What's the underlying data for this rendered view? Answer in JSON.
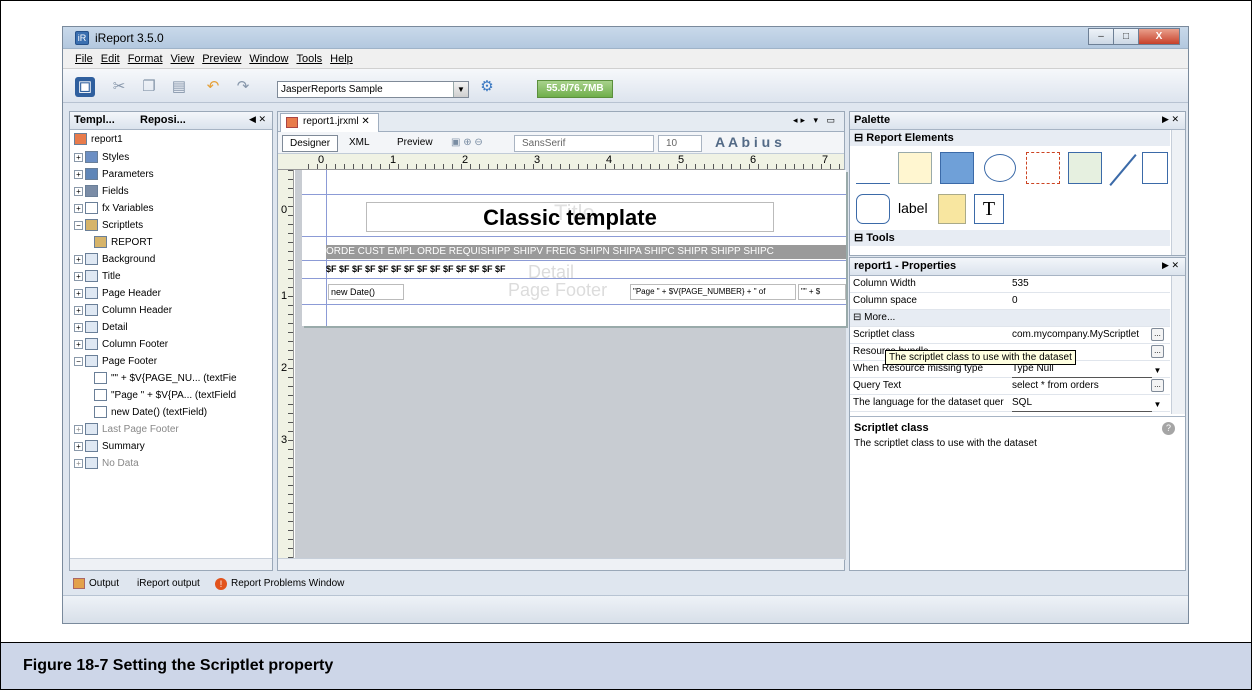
{
  "window": {
    "title": "iReport 3.5.0",
    "minimize": "–",
    "maximize": "□",
    "close": "X"
  },
  "menu": [
    "File",
    "Edit",
    "Format",
    "View",
    "Preview",
    "Window",
    "Tools",
    "Help"
  ],
  "toolbar": {
    "datasource": "JasperReports Sample",
    "memory": "55.8/76.7MB"
  },
  "left_panel": {
    "tabs": [
      "Templ...",
      "Reposi..."
    ],
    "root": "report1",
    "tree": [
      {
        "label": "Styles",
        "icon": "styles-icon"
      },
      {
        "label": "Parameters",
        "icon": "parameters-icon"
      },
      {
        "label": "Fields",
        "icon": "fields-icon"
      },
      {
        "label": "fx Variables",
        "icon": "variables-icon"
      },
      {
        "label": "Scriptlets",
        "icon": "scriptlets-icon",
        "expanded": true
      },
      {
        "label": "REPORT",
        "icon": "scriptlet-item-icon",
        "child": true
      },
      {
        "label": "Background",
        "icon": "band-icon"
      },
      {
        "label": "Title",
        "icon": "band-icon"
      },
      {
        "label": "Page Header",
        "icon": "band-icon"
      },
      {
        "label": "Column Header",
        "icon": "band-icon"
      },
      {
        "label": "Detail",
        "icon": "band-icon"
      },
      {
        "label": "Column Footer",
        "icon": "band-icon"
      },
      {
        "label": "Page Footer",
        "icon": "band-icon",
        "expanded": true
      },
      {
        "label": "\"\" + $V{PAGE_NU... (textFie",
        "icon": "textfield-icon",
        "child": true
      },
      {
        "label": "\"Page \" + $V{PA... (textField",
        "icon": "textfield-icon",
        "child": true
      },
      {
        "label": "new Date() (textField)",
        "icon": "textfield-icon",
        "child": true
      },
      {
        "label": "Last Page Footer",
        "icon": "band-icon",
        "dim": true
      },
      {
        "label": "Summary",
        "icon": "band-icon"
      },
      {
        "label": "No Data",
        "icon": "band-icon",
        "dim": true
      }
    ]
  },
  "editor": {
    "tab": "report1.jrxml",
    "modes": [
      "Designer",
      "XML",
      "Preview"
    ],
    "font": "SansSerif",
    "font_size": "10",
    "ruler_ticks": [
      "0",
      "1",
      "2",
      "3",
      "4",
      "5",
      "6",
      "7"
    ],
    "vruler_ticks": [
      "0",
      "1",
      "2",
      "3"
    ],
    "title_text": "Classic template",
    "title_ghost": "Title",
    "detail_ghost": "Detail",
    "footer_ghost": "Page Footer",
    "column_headers": "ORDE CUST EMPL ORDE REQUISHIPP SHIPV FREIG SHIPN SHIPA SHIPC SHIPR SHIPP SHIPC",
    "detail_fields": "$F    $F    $F    $F    $F    $F    $F    $F    $F    $F    $F    $F    $F    $F",
    "footer_date": "new Date()",
    "footer_page": "\"Page \" + $V{PAGE_NUMBER} + \" of",
    "footer_page2": "\"\" + $"
  },
  "palette": {
    "title": "Palette",
    "section_elements": "Report Elements",
    "label_item": "label",
    "section_tools": "Tools"
  },
  "properties": {
    "title": "report1 - Properties",
    "rows": [
      {
        "key": "Column Width",
        "value": "535"
      },
      {
        "key": "Column space",
        "value": "0"
      },
      {
        "key": "⊟ More...",
        "value": ""
      },
      {
        "key": "Scriptlet class",
        "value": "com.mycompany.MyScriptlet",
        "button": true
      },
      {
        "key": "Resource bundle",
        "value": "",
        "button": true
      },
      {
        "key": "When Resource missing type",
        "value": "Type Null",
        "dropdown": true
      },
      {
        "key": "Query Text",
        "value": "select * from orders",
        "button": true
      },
      {
        "key": "The language for the dataset quer",
        "value": "SQL",
        "dropdown": true
      }
    ],
    "tooltip": "The scriptlet class to use with the dataset",
    "help_title": "Scriptlet class",
    "help_text": "The scriptlet class to use with the dataset"
  },
  "status": {
    "output": "Output",
    "ireport_output": "iReport output",
    "problems": "Report Problems Window"
  },
  "caption": "Figure 18-7    Setting the Scriptlet property"
}
